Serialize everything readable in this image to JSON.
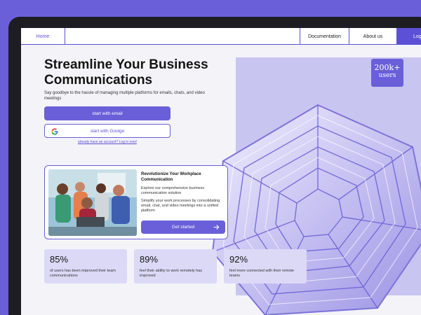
{
  "nav": {
    "home": "Home",
    "documentation": "Documentation",
    "about": "About us",
    "login": "Log"
  },
  "hero": {
    "title": "Streamline Your Business Communications",
    "subtitle": "Say goodbye to the hassle of managing multiple platforms for emails, chats, and video meetings",
    "email_button": "start with email",
    "google_button": "start with Goolgo",
    "login_link": "already have an account? Log in now!"
  },
  "badge": {
    "number": "200k+",
    "label": "users"
  },
  "card": {
    "title": "Revolutionize Your Workplace Communication",
    "desc1": "Explore our comprehensive business communication solution",
    "desc2": "Simplify your work processes by consolidating email, chat, and video meetings into a unified platform",
    "button": "Get started"
  },
  "stats": [
    {
      "value": "85%",
      "text": "of users has been improved their team communications"
    },
    {
      "value": "89%",
      "text": "feel their ability to work remotely has improved"
    },
    {
      "value": "92%",
      "text": "feel more connected with their remote teams"
    }
  ],
  "colors": {
    "accent": "#6a5fd9",
    "background": "#f4f3f8",
    "panel": "#c9c5f1",
    "stat_card": "#dcd9f7"
  },
  "icons": {
    "google": "google-g-icon",
    "arrow": "arrow-right-icon"
  }
}
